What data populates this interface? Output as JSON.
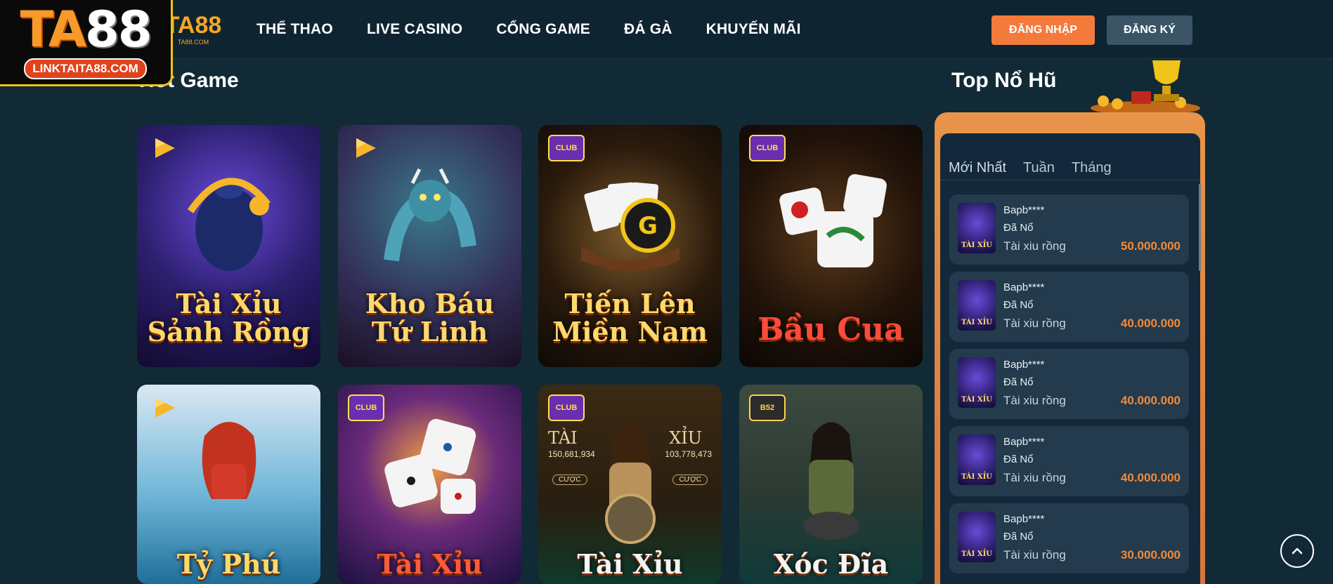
{
  "header": {
    "small_logo_text": "TA88",
    "small_logo_url": "TA88.COM",
    "nav": [
      "THỂ THAO",
      "LIVE CASINO",
      "CỔNG GAME",
      "ĐÁ GÀ",
      "KHUYẾN MÃI"
    ],
    "login_label": "ĐĂNG NHẬP",
    "register_label": "ĐĂNG KÝ"
  },
  "overlay_logo": {
    "brand_orange": "TA",
    "brand_white": "88",
    "url": "LINKTAITA88.COM"
  },
  "hot_game": {
    "title": "Hot Game",
    "games": [
      {
        "name": "Tài Xỉu Sảnh Rồng",
        "badge": "play"
      },
      {
        "name": "Kho Báu Tứ Linh",
        "badge": "play"
      },
      {
        "name": "Tiến Lên Miền Nam",
        "badge": "club"
      },
      {
        "name": "Bầu Cua",
        "badge": "club"
      },
      {
        "name": "Tỷ Phú",
        "badge": "play"
      },
      {
        "name": "Tài Xỉu",
        "badge": "club"
      },
      {
        "name": "Tài Xỉu",
        "badge": "club"
      },
      {
        "name": "Xóc Đĩa",
        "badge": "b52"
      }
    ],
    "g7_labels": {
      "left": "TÀI",
      "right": "XỈU",
      "left_value": "150,681,934",
      "right_value": "103,778,473",
      "button": "CƯỢC"
    }
  },
  "top_no_hu": {
    "title": "Top Nổ Hũ",
    "tabs": [
      "Mới Nhất",
      "Tuần",
      "Tháng"
    ],
    "entries": [
      {
        "user": "Bapb****",
        "status": "Đã Nổ",
        "game": "Tài xiu rồng",
        "amount": "50.000.000"
      },
      {
        "user": "Bapb****",
        "status": "Đã Nổ",
        "game": "Tài xiu rồng",
        "amount": "40.000.000"
      },
      {
        "user": "Bapb****",
        "status": "Đã Nổ",
        "game": "Tài xiu rồng",
        "amount": "40.000.000"
      },
      {
        "user": "Bapb****",
        "status": "Đã Nổ",
        "game": "Tài xiu rồng",
        "amount": "40.000.000"
      },
      {
        "user": "Bapb****",
        "status": "Đã Nổ",
        "game": "Tài xiu rồng",
        "amount": "30.000.000"
      }
    ]
  },
  "colors": {
    "accent": "#f47a3c",
    "amount": "#f28a3c",
    "background": "#122a36"
  },
  "icons": {
    "scroll_top": "chevron-up-icon"
  }
}
